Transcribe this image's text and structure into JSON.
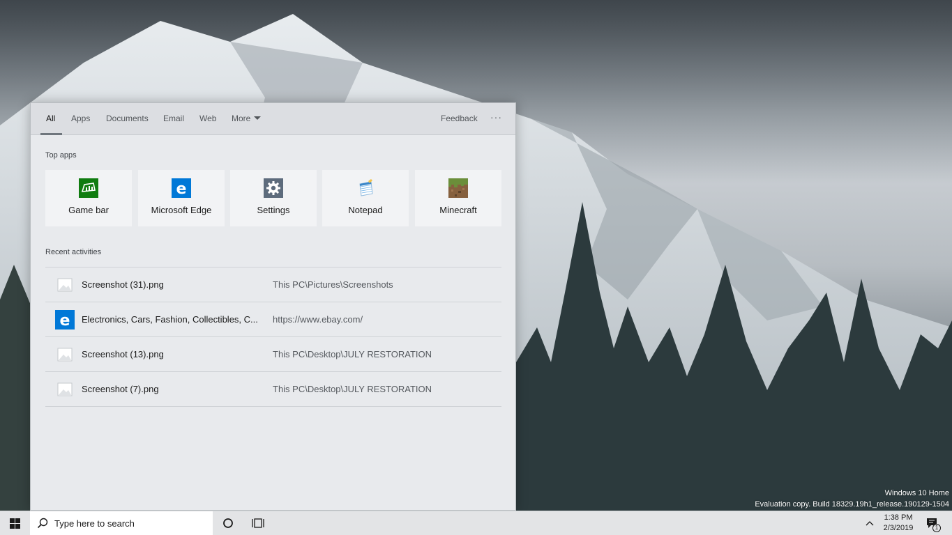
{
  "desktop": {
    "watermark": {
      "edition": "Windows 10 Home",
      "build": "Evaluation copy. Build 18329.19h1_release.190129-1504"
    }
  },
  "search_panel": {
    "tabs": [
      {
        "label": "All",
        "active": true
      },
      {
        "label": "Apps",
        "active": false
      },
      {
        "label": "Documents",
        "active": false
      },
      {
        "label": "Email",
        "active": false
      },
      {
        "label": "Web",
        "active": false
      },
      {
        "label": "More",
        "active": false
      }
    ],
    "feedback_label": "Feedback",
    "more_options_label": "···",
    "top_apps_title": "Top apps",
    "top_apps": [
      {
        "label": "Game bar",
        "icon": "game-bar-icon",
        "color": "#107c10"
      },
      {
        "label": "Microsoft Edge",
        "icon": "edge-icon",
        "color": "#0078d7"
      },
      {
        "label": "Settings",
        "icon": "gear-icon",
        "color": "#5d6b7c"
      },
      {
        "label": "Notepad",
        "icon": "notepad-icon",
        "color": "#6fb1e6"
      },
      {
        "label": "Minecraft",
        "icon": "minecraft-icon",
        "color": "#6b8e3a"
      }
    ],
    "recent_title": "Recent activities",
    "recent": [
      {
        "name": "Screenshot (31).png",
        "path": "This PC\\Pictures\\Screenshots",
        "icon": "image-file-icon"
      },
      {
        "name": "Electronics, Cars, Fashion, Collectibles, C...",
        "path": "https://www.ebay.com/",
        "icon": "edge-icon"
      },
      {
        "name": "Screenshot (13).png",
        "path": "This PC\\Desktop\\JULY RESTORATION",
        "icon": "image-file-icon"
      },
      {
        "name": "Screenshot (7).png",
        "path": "This PC\\Desktop\\JULY RESTORATION",
        "icon": "image-file-icon"
      }
    ]
  },
  "taskbar": {
    "search_placeholder": "Type here to search",
    "time": "1:38 PM",
    "date": "2/3/2019",
    "notification_count": "1",
    "accent_color": "#0078d7"
  }
}
